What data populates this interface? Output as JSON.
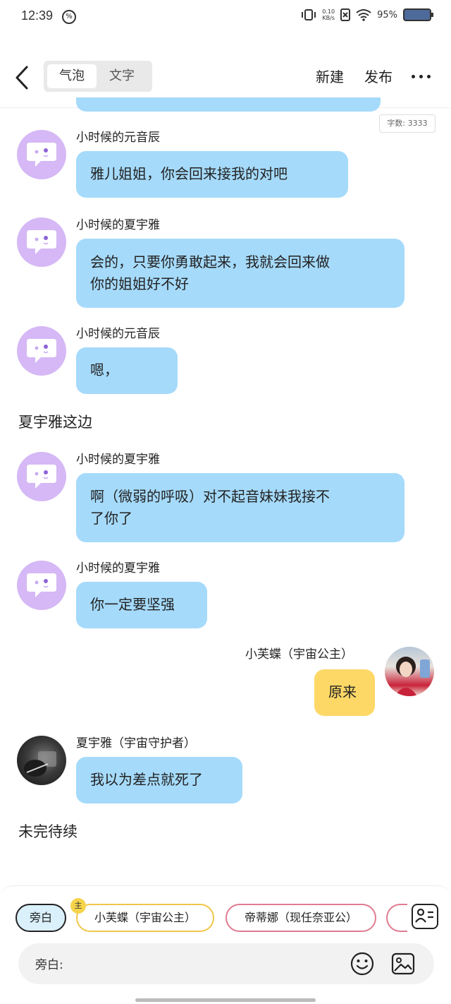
{
  "status_bar": {
    "time": "12:39",
    "hd_badge": "%",
    "net_speed_value": "0.10",
    "net_speed_unit": "KB/s",
    "battery_percent": "95%"
  },
  "header": {
    "tabs": [
      {
        "label": "气泡",
        "active": true
      },
      {
        "label": "文字",
        "active": false
      }
    ],
    "new_label": "新建",
    "publish_label": "发布"
  },
  "word_count": "字数: 3333",
  "messages": [
    {
      "speaker": "小时候的元音辰",
      "lines": [
        "雅儿姐姐，你会回来接我的对吧"
      ],
      "side": "left",
      "avatar": "default-chat-icon"
    },
    {
      "speaker": "小时候的夏宇雅",
      "lines": [
        "会的，只要你勇敢起来，我就会回来做",
        "你的姐姐好不好"
      ],
      "side": "left",
      "avatar": "default-chat-icon"
    },
    {
      "speaker": "小时候的元音辰",
      "lines": [
        "嗯，"
      ],
      "side": "left",
      "avatar": "default-chat-icon"
    },
    {
      "speaker": "小时候的夏宇雅",
      "lines": [
        "啊（微弱的呼吸）对不起音妹妹我接不",
        "了你了"
      ],
      "side": "left",
      "avatar": "default-chat-icon"
    },
    {
      "speaker": "小时候的夏宇雅",
      "lines": [
        "你一定要坚强"
      ],
      "side": "left",
      "avatar": "default-chat-icon"
    },
    {
      "speaker": "小芙蝶（宇宙公主）",
      "lines": [
        "原来"
      ],
      "side": "right",
      "avatar": "photo"
    },
    {
      "speaker": "夏宇雅（宇宙守护者）",
      "lines": [
        "我以为差点就死了"
      ],
      "side": "left",
      "avatar": "photo"
    }
  ],
  "narrations": [
    "夏宇雅这边",
    "未完待续"
  ],
  "bottom": {
    "chips": [
      "旁白",
      "小芙蝶（宇宙公主）",
      "帝蒂娜（现任奈亚公）"
    ],
    "main_badge": "主",
    "input_label": "旁白:"
  },
  "colors": {
    "bubble_blue": "#a5dafa",
    "bubble_yellow": "#fdd867",
    "avatar_purple": "#d5b8f5",
    "chip_gold": "#f0c64a",
    "chip_pink": "#e07b90"
  }
}
